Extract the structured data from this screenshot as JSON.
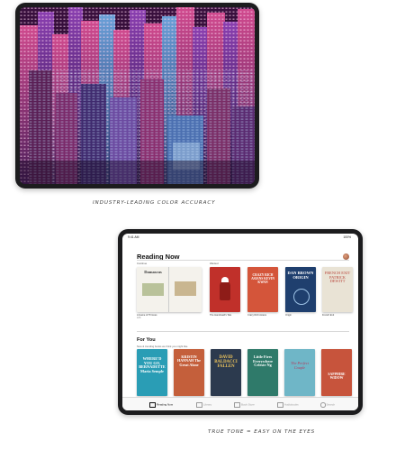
{
  "captions": {
    "top": "INDUSTRY-LEADING COLOR ACCURACY",
    "bottom": "TRUE TONE = EASY ON THE EYES"
  },
  "books_app": {
    "status_time": "9:41 AM",
    "status_battery": "100%",
    "title": "Reading Now",
    "sections": {
      "continue": "Continue",
      "wanted": "Wanted"
    },
    "reading_now": [
      {
        "title": "A Game of Thrones",
        "cover_text": "Damascus",
        "progress": "12%",
        "color": "#e8e6df"
      },
      {
        "title": "The Handmaid's Tale",
        "cover_text": "",
        "progress": "",
        "color": "#c0302a"
      },
      {
        "title": "Crazy Rich Asians",
        "cover_text": "CRAZY RICH ASIANS KEVIN KWAN",
        "progress": "",
        "color": "#d4553a"
      },
      {
        "title": "Origin",
        "cover_text": "DAN BROWN ORIGIN",
        "progress": "",
        "color": "#1f3f6e"
      },
      {
        "title": "French Exit",
        "cover_text": "FRENCH EXIT PATRICK DEWITT",
        "progress": "",
        "color": "#e9e3d5"
      }
    ],
    "for_you": {
      "title": "For You",
      "subtitle": "New & trending books we think you might like.",
      "books": [
        {
          "cover_text": "WHERE'D YOU GO, BERNADETTE Maria Semple",
          "color": "#2a9db5"
        },
        {
          "cover_text": "KRISTIN HANNAH The Great Alone",
          "color": "#c45f3b"
        },
        {
          "cover_text": "DAVID BALDACCI FALLEN",
          "color": "#2c3a4e"
        },
        {
          "cover_text": "Little Fires Everywhere Celeste Ng",
          "color": "#2f7a6a"
        },
        {
          "cover_text": "The Perfect Couple",
          "color": "#6fb6c7"
        },
        {
          "cover_text": "SAPPHIRE WIDOW",
          "color": "#c7543c"
        }
      ]
    },
    "tabs": [
      {
        "label": "Reading Now",
        "active": true
      },
      {
        "label": "Library",
        "active": false
      },
      {
        "label": "Book Store",
        "active": false
      },
      {
        "label": "Audiobooks",
        "active": false
      },
      {
        "label": "Search",
        "active": false
      }
    ]
  }
}
